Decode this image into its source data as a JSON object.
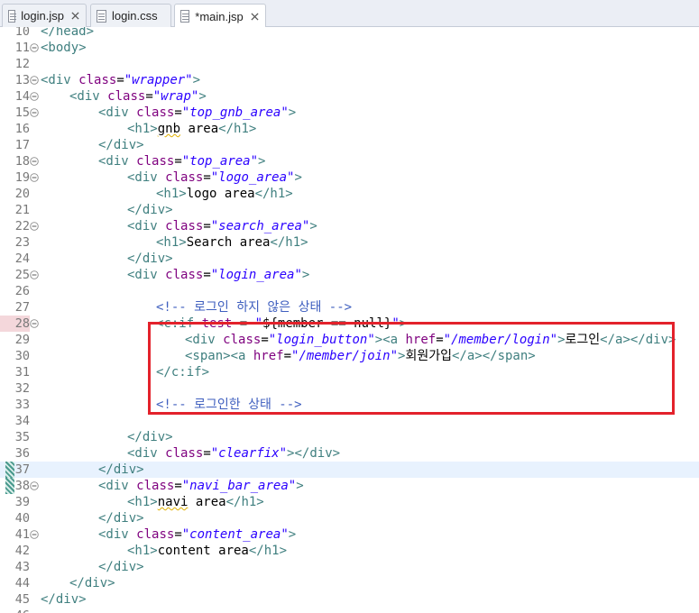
{
  "tabs": [
    {
      "label": "login.jsp",
      "active": false,
      "closable": true
    },
    {
      "label": "login.css",
      "active": false,
      "closable": false
    },
    {
      "label": "*main.jsp",
      "active": true,
      "closable": true
    }
  ],
  "colors": {
    "highlight_box": "#e3222b",
    "tag": "#3f7f7f",
    "attribute": "#7f007f",
    "string": "#2a00ff",
    "comment": "#3f5fbf"
  },
  "current_line": 37,
  "breakpoint_line": 28,
  "lines": [
    {
      "n": "10",
      "indent": 0,
      "fold": false,
      "parts": [
        [
          "tag",
          "</head>"
        ]
      ]
    },
    {
      "n": "11",
      "indent": 0,
      "fold": true,
      "parts": [
        [
          "tag",
          "<body>"
        ]
      ]
    },
    {
      "n": "12",
      "indent": 0,
      "fold": false,
      "parts": []
    },
    {
      "n": "13",
      "indent": 0,
      "fold": true,
      "parts": [
        [
          "tag",
          "<div "
        ],
        [
          "attr",
          "class"
        ],
        [
          "txt",
          "="
        ],
        [
          "str",
          "\"wrapper\""
        ],
        [
          "tag",
          ">"
        ]
      ]
    },
    {
      "n": "14",
      "indent": 1,
      "fold": true,
      "parts": [
        [
          "tag",
          "<div "
        ],
        [
          "attr",
          "class"
        ],
        [
          "txt",
          "="
        ],
        [
          "str",
          "\"wrap\""
        ],
        [
          "tag",
          ">"
        ]
      ]
    },
    {
      "n": "15",
      "indent": 2,
      "fold": true,
      "parts": [
        [
          "tag",
          "<div "
        ],
        [
          "attr",
          "class"
        ],
        [
          "txt",
          "="
        ],
        [
          "str",
          "\"top_gnb_area\""
        ],
        [
          "tag",
          ">"
        ]
      ]
    },
    {
      "n": "16",
      "indent": 3,
      "fold": false,
      "parts": [
        [
          "tag",
          "<h1>"
        ],
        [
          "sq",
          "gnb"
        ],
        [
          "txt",
          " area"
        ],
        [
          "tag",
          "</h1>"
        ]
      ]
    },
    {
      "n": "17",
      "indent": 2,
      "fold": false,
      "parts": [
        [
          "tag",
          "</div>"
        ]
      ]
    },
    {
      "n": "18",
      "indent": 2,
      "fold": true,
      "parts": [
        [
          "tag",
          "<div "
        ],
        [
          "attr",
          "class"
        ],
        [
          "txt",
          "="
        ],
        [
          "str",
          "\"top_area\""
        ],
        [
          "tag",
          ">"
        ]
      ]
    },
    {
      "n": "19",
      "indent": 3,
      "fold": true,
      "parts": [
        [
          "tag",
          "<div "
        ],
        [
          "attr",
          "class"
        ],
        [
          "txt",
          "="
        ],
        [
          "str",
          "\"logo_area\""
        ],
        [
          "tag",
          ">"
        ]
      ]
    },
    {
      "n": "20",
      "indent": 4,
      "fold": false,
      "parts": [
        [
          "tag",
          "<h1>"
        ],
        [
          "txt",
          "logo area"
        ],
        [
          "tag",
          "</h1>"
        ]
      ]
    },
    {
      "n": "21",
      "indent": 3,
      "fold": false,
      "parts": [
        [
          "tag",
          "</div>"
        ]
      ]
    },
    {
      "n": "22",
      "indent": 3,
      "fold": true,
      "parts": [
        [
          "tag",
          "<div "
        ],
        [
          "attr",
          "class"
        ],
        [
          "txt",
          "="
        ],
        [
          "str",
          "\"search_area\""
        ],
        [
          "tag",
          ">"
        ]
      ]
    },
    {
      "n": "23",
      "indent": 4,
      "fold": false,
      "parts": [
        [
          "tag",
          "<h1>"
        ],
        [
          "txt",
          "Search area"
        ],
        [
          "tag",
          "</h1>"
        ]
      ]
    },
    {
      "n": "24",
      "indent": 3,
      "fold": false,
      "parts": [
        [
          "tag",
          "</div>"
        ]
      ]
    },
    {
      "n": "25",
      "indent": 3,
      "fold": true,
      "parts": [
        [
          "tag",
          "<div "
        ],
        [
          "attr",
          "class"
        ],
        [
          "txt",
          "="
        ],
        [
          "str",
          "\"login_area\""
        ],
        [
          "tag",
          ">"
        ]
      ]
    },
    {
      "n": "26",
      "indent": 0,
      "fold": false,
      "parts": []
    },
    {
      "n": "27",
      "indent": 4,
      "fold": false,
      "parts": [
        [
          "cmt",
          "<!-- 로그인 하지 않은 상태 -->"
        ]
      ]
    },
    {
      "n": "28",
      "indent": 4,
      "fold": true,
      "parts": [
        [
          "tag",
          "<c:if "
        ],
        [
          "attr",
          "test"
        ],
        [
          "txt",
          " = "
        ],
        [
          "str",
          "\""
        ],
        [
          "jsp",
          "${member == null}"
        ],
        [
          "str",
          "\""
        ],
        [
          "tag",
          ">"
        ]
      ]
    },
    {
      "n": "29",
      "indent": 5,
      "fold": false,
      "parts": [
        [
          "tag",
          "<div "
        ],
        [
          "attr",
          "class"
        ],
        [
          "txt",
          "="
        ],
        [
          "str",
          "\"login_button\""
        ],
        [
          "tag",
          "><a "
        ],
        [
          "attr",
          "href"
        ],
        [
          "txt",
          "="
        ],
        [
          "str",
          "\"/member/login\""
        ],
        [
          "tag",
          ">"
        ],
        [
          "txt",
          "로그인"
        ],
        [
          "tag",
          "</a></div>"
        ]
      ]
    },
    {
      "n": "30",
      "indent": 5,
      "fold": false,
      "parts": [
        [
          "tag",
          "<span><a "
        ],
        [
          "attr",
          "href"
        ],
        [
          "txt",
          "="
        ],
        [
          "str",
          "\"/member/join\""
        ],
        [
          "tag",
          ">"
        ],
        [
          "txt",
          "회원가입"
        ],
        [
          "tag",
          "</a></span>"
        ]
      ]
    },
    {
      "n": "31",
      "indent": 4,
      "fold": false,
      "parts": [
        [
          "tag",
          "</c:if>"
        ]
      ]
    },
    {
      "n": "32",
      "indent": 0,
      "fold": false,
      "parts": []
    },
    {
      "n": "33",
      "indent": 4,
      "fold": false,
      "parts": [
        [
          "cmt",
          "<!-- 로그인한 상태 -->"
        ]
      ]
    },
    {
      "n": "34",
      "indent": 0,
      "fold": false,
      "parts": []
    },
    {
      "n": "35",
      "indent": 3,
      "fold": false,
      "parts": [
        [
          "tag",
          "</div>"
        ]
      ]
    },
    {
      "n": "36",
      "indent": 3,
      "fold": false,
      "parts": [
        [
          "tag",
          "<div "
        ],
        [
          "attr",
          "class"
        ],
        [
          "txt",
          "="
        ],
        [
          "str",
          "\"clearfix\""
        ],
        [
          "tag",
          "></div>"
        ]
      ]
    },
    {
      "n": "37",
      "indent": 2,
      "fold": false,
      "parts": [
        [
          "tag",
          "</div>"
        ]
      ]
    },
    {
      "n": "38",
      "indent": 2,
      "fold": true,
      "parts": [
        [
          "tag",
          "<div "
        ],
        [
          "attr",
          "class"
        ],
        [
          "txt",
          "="
        ],
        [
          "str",
          "\"navi_bar_area\""
        ],
        [
          "tag",
          ">"
        ]
      ]
    },
    {
      "n": "39",
      "indent": 3,
      "fold": false,
      "parts": [
        [
          "tag",
          "<h1>"
        ],
        [
          "sq",
          "navi"
        ],
        [
          "txt",
          " area"
        ],
        [
          "tag",
          "</h1>"
        ]
      ]
    },
    {
      "n": "40",
      "indent": 2,
      "fold": false,
      "parts": [
        [
          "tag",
          "</div>"
        ]
      ]
    },
    {
      "n": "41",
      "indent": 2,
      "fold": true,
      "parts": [
        [
          "tag",
          "<div "
        ],
        [
          "attr",
          "class"
        ],
        [
          "txt",
          "="
        ],
        [
          "str",
          "\"content_area\""
        ],
        [
          "tag",
          ">"
        ]
      ]
    },
    {
      "n": "42",
      "indent": 3,
      "fold": false,
      "parts": [
        [
          "tag",
          "<h1>"
        ],
        [
          "txt",
          "content area"
        ],
        [
          "tag",
          "</h1>"
        ]
      ]
    },
    {
      "n": "43",
      "indent": 2,
      "fold": false,
      "parts": [
        [
          "tag",
          "</div>"
        ]
      ]
    },
    {
      "n": "44",
      "indent": 1,
      "fold": false,
      "parts": [
        [
          "tag",
          "</div>"
        ]
      ]
    },
    {
      "n": "45",
      "indent": 0,
      "fold": false,
      "parts": [
        [
          "tag",
          "</div>"
        ]
      ]
    },
    {
      "n": "46",
      "indent": 0,
      "fold": false,
      "parts": []
    }
  ]
}
